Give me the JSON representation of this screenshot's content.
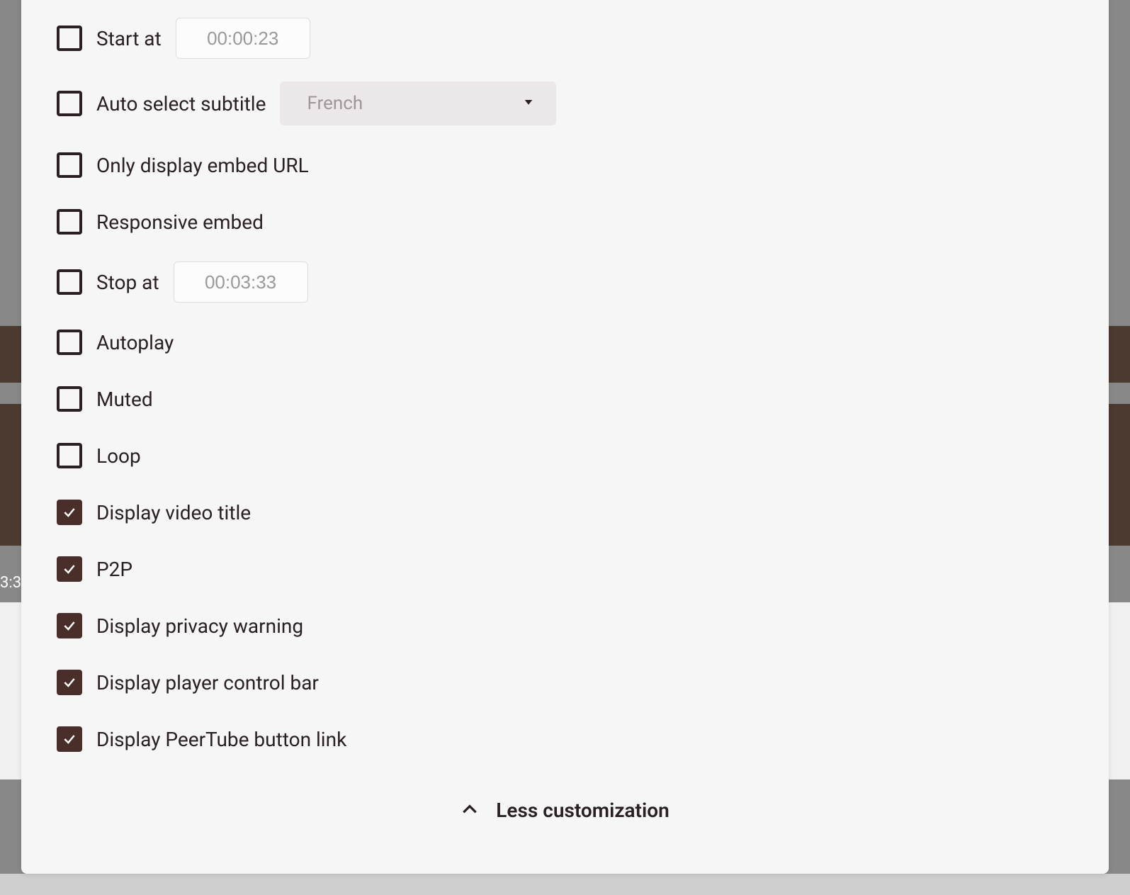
{
  "background": {
    "time_fragment": "3:3"
  },
  "options": {
    "start_at": {
      "label": "Start at",
      "checked": false,
      "value": "00:00:23"
    },
    "auto_subtitle": {
      "label": "Auto select subtitle",
      "checked": false,
      "selected": "French"
    },
    "only_embed_url": {
      "label": "Only display embed URL",
      "checked": false
    },
    "responsive_embed": {
      "label": "Responsive embed",
      "checked": false
    },
    "stop_at": {
      "label": "Stop at",
      "checked": false,
      "value": "00:03:33"
    },
    "autoplay": {
      "label": "Autoplay",
      "checked": false
    },
    "muted": {
      "label": "Muted",
      "checked": false
    },
    "loop": {
      "label": "Loop",
      "checked": false
    },
    "display_title": {
      "label": "Display video title",
      "checked": true
    },
    "p2p": {
      "label": "P2P",
      "checked": true
    },
    "privacy_warning": {
      "label": "Display privacy warning",
      "checked": true
    },
    "control_bar": {
      "label": "Display player control bar",
      "checked": true
    },
    "peertube_link": {
      "label": "Display PeerTube button link",
      "checked": true
    }
  },
  "toggle": {
    "less_label": "Less customization"
  }
}
